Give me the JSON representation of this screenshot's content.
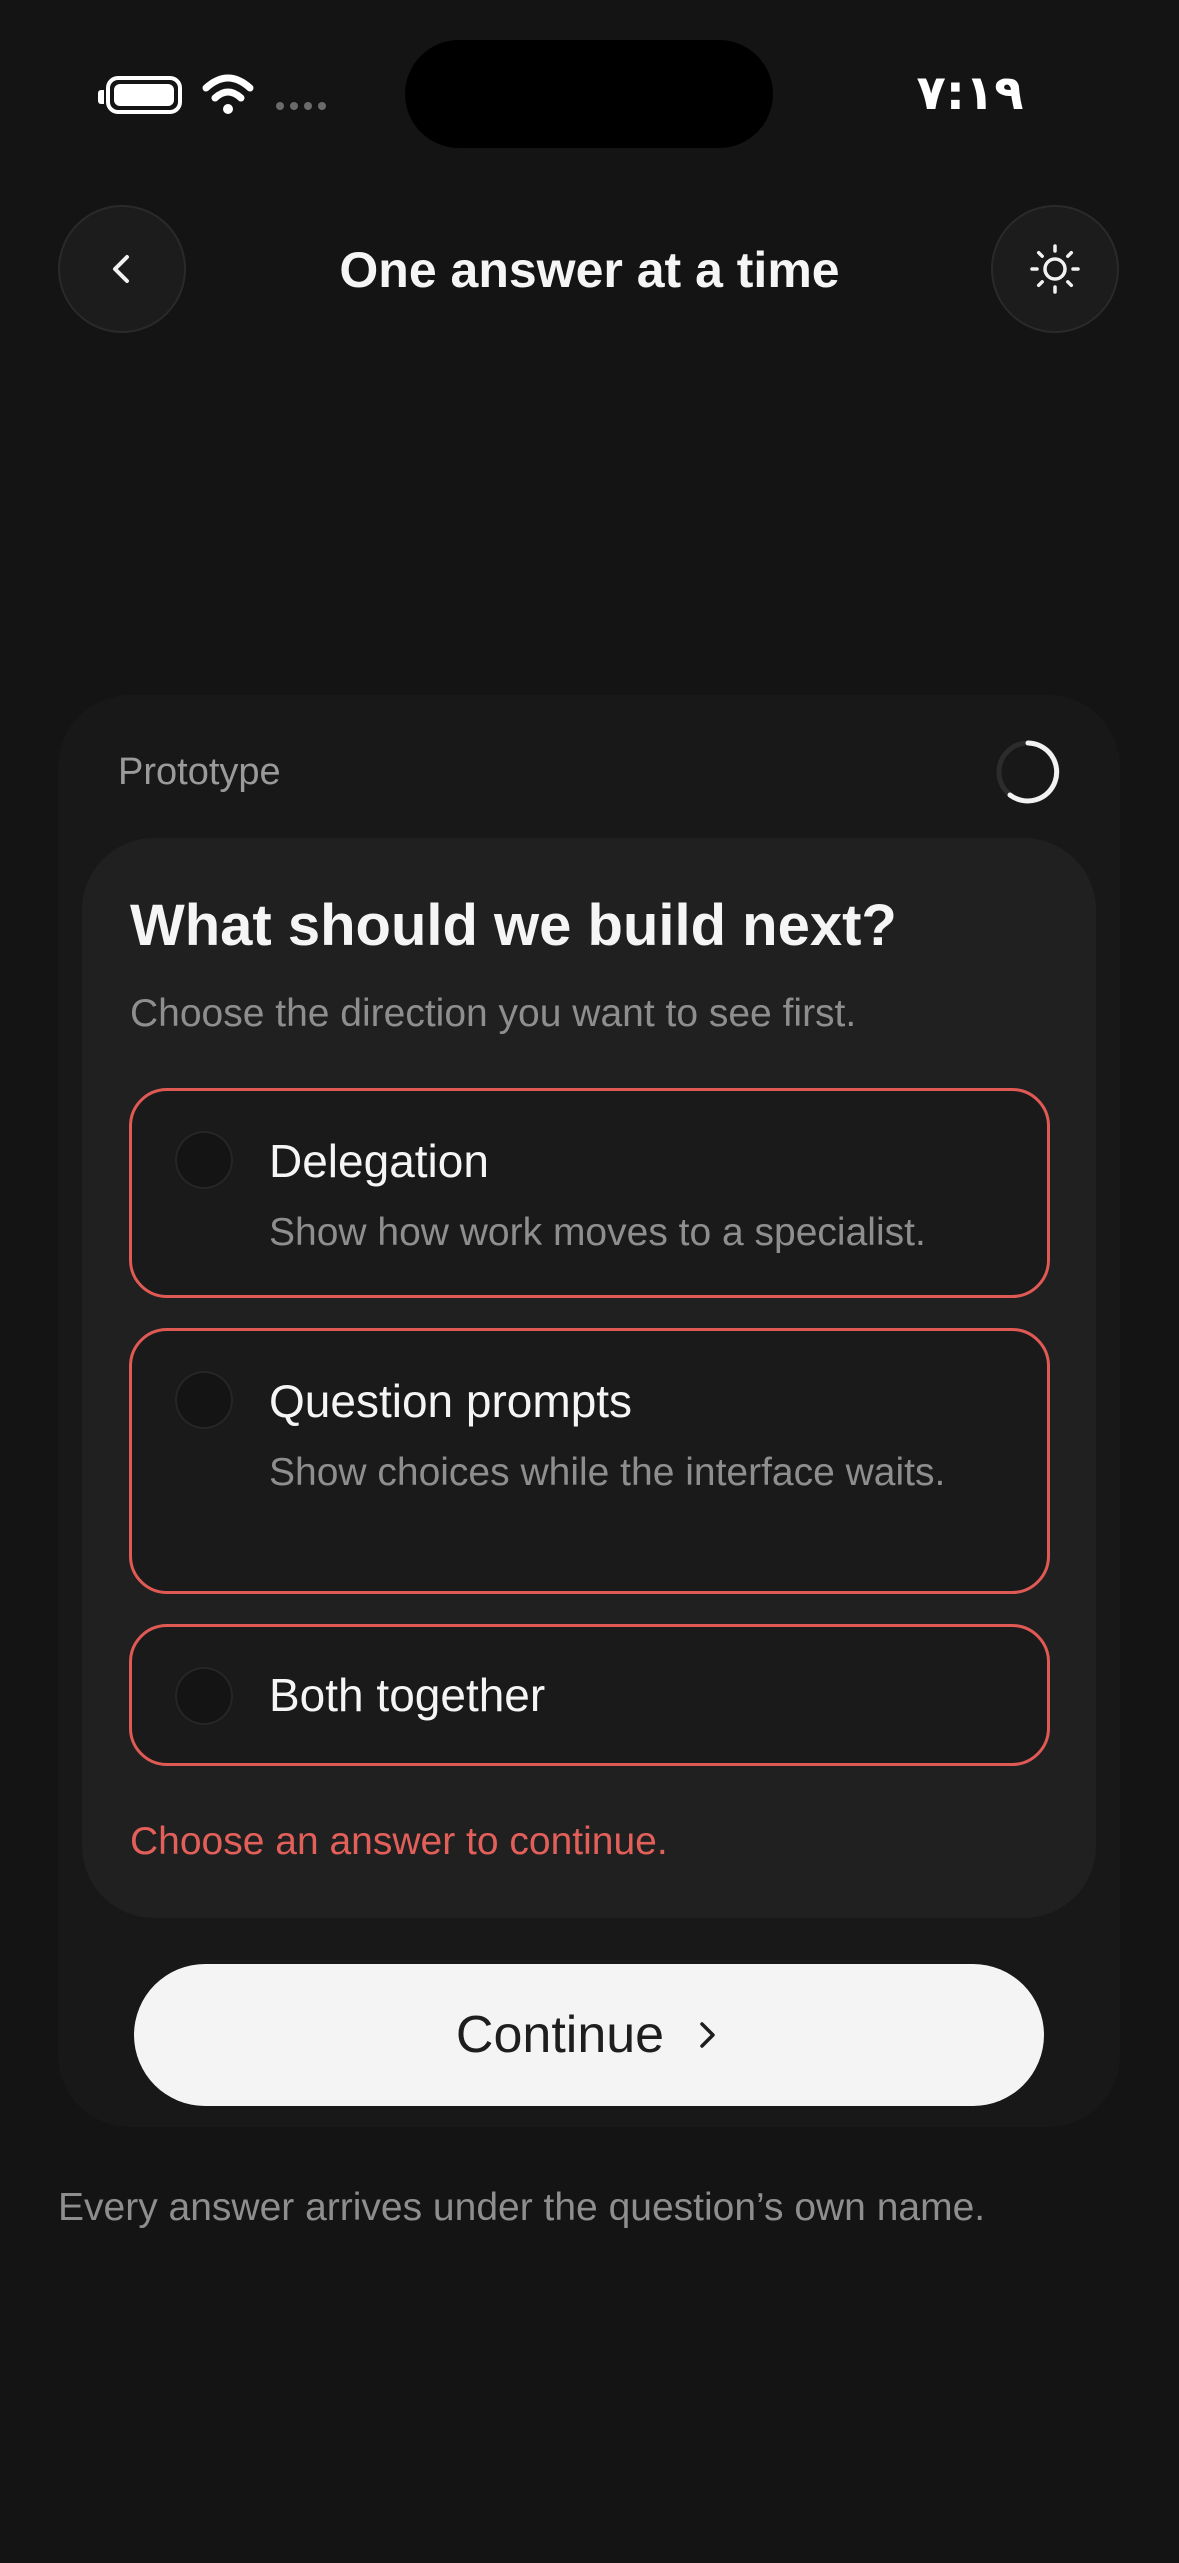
{
  "status_bar": {
    "time": "۷:۱۹",
    "battery_icon": "battery-full-icon",
    "wifi_icon": "wifi-icon",
    "signal_icon": "cellular-signal-icon"
  },
  "header": {
    "title": "One answer at a time",
    "back_icon": "chevron-left-icon",
    "theme_icon": "sun-icon"
  },
  "card": {
    "label": "Prototype",
    "loading_icon": "spinner-icon",
    "question": "What should we build next?",
    "helper": "Choose the direction you want to see first.",
    "options": [
      {
        "title": "Delegation",
        "description": "Show how work moves to a specialist.",
        "selected": false
      },
      {
        "title": "Question prompts",
        "description": "Show choices while the interface waits.",
        "selected": false
      },
      {
        "title": "Both together",
        "description": "",
        "selected": false
      }
    ],
    "error": "Choose an answer to continue.",
    "continue_label": "Continue",
    "continue_icon": "chevron-right-icon"
  },
  "footer_note": "Every answer arrives under the question’s own name.",
  "colors": {
    "background": "#141414",
    "error_accent": "#e05a55",
    "button_bg": "#f4f4f4"
  }
}
